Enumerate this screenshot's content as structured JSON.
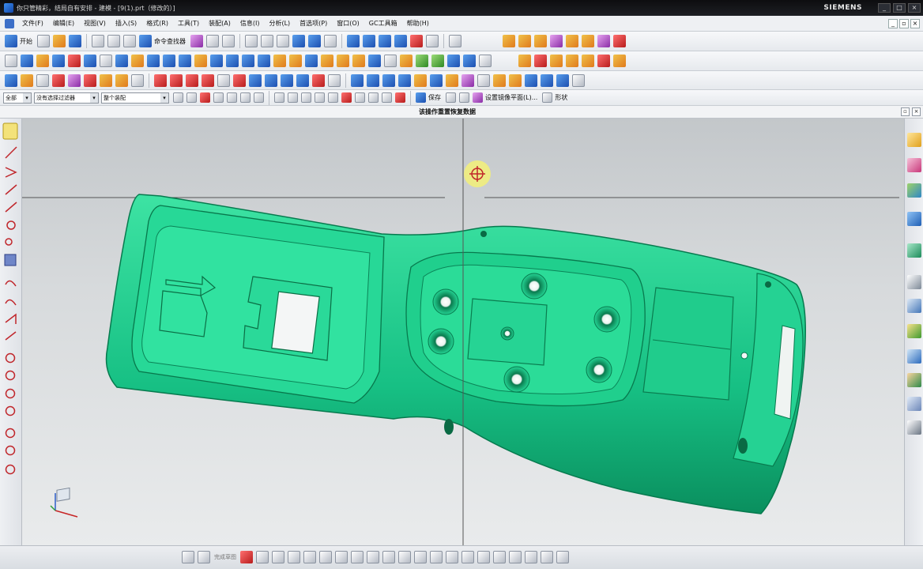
{
  "window": {
    "title": "你只管精彩，结局自有安排 - 建模 - [9(1).prt（修改的）]",
    "brand": "SIEMENS",
    "controls": [
      "_",
      "□",
      "×"
    ]
  },
  "menubar": {
    "items": [
      "文件(F)",
      "编辑(E)",
      "视图(V)",
      "插入(S)",
      "格式(R)",
      "工具(T)",
      "装配(A)",
      "信息(I)",
      "分析(L)",
      "首选项(P)",
      "窗口(O)",
      "GC工具箱",
      "帮助(H)"
    ]
  },
  "toolbar_standard": {
    "start_label": "开始",
    "command_finder_label": "命令查找器"
  },
  "selection_bar": {
    "filter_scope": "全部",
    "type_filter": "没有选择过滤器",
    "assembly_scope": "整个装配",
    "save_label": "保存",
    "work_plane_label": "设置镜像平面(L)...",
    "shape_label": "形状"
  },
  "viewport": {
    "caption": "该操作重置恢复数据",
    "model_color": "#1fc98c",
    "background_top": "#c3c7ca",
    "background_bottom": "#e9ebec"
  },
  "bottom_bar": {
    "finish_sketch_label": "完成草图"
  },
  "icons": {
    "left": [
      "sketch-icon",
      "line-icon",
      "profile-icon",
      "offset-icon",
      "trim-icon",
      "arc-icon",
      "circle-icon",
      "fillet-icon",
      "chamfer-icon",
      "spline-icon",
      "point-icon",
      "constraint-icon"
    ],
    "right": [
      "part-navigator-icon",
      "assembly-navigator-icon",
      "reuse-library-icon",
      "web-browser-icon",
      "history-icon",
      "system-materials-icon",
      "process-studio-icon",
      "roles-icon",
      "palettes-icon",
      "system-scenes-icon"
    ]
  }
}
